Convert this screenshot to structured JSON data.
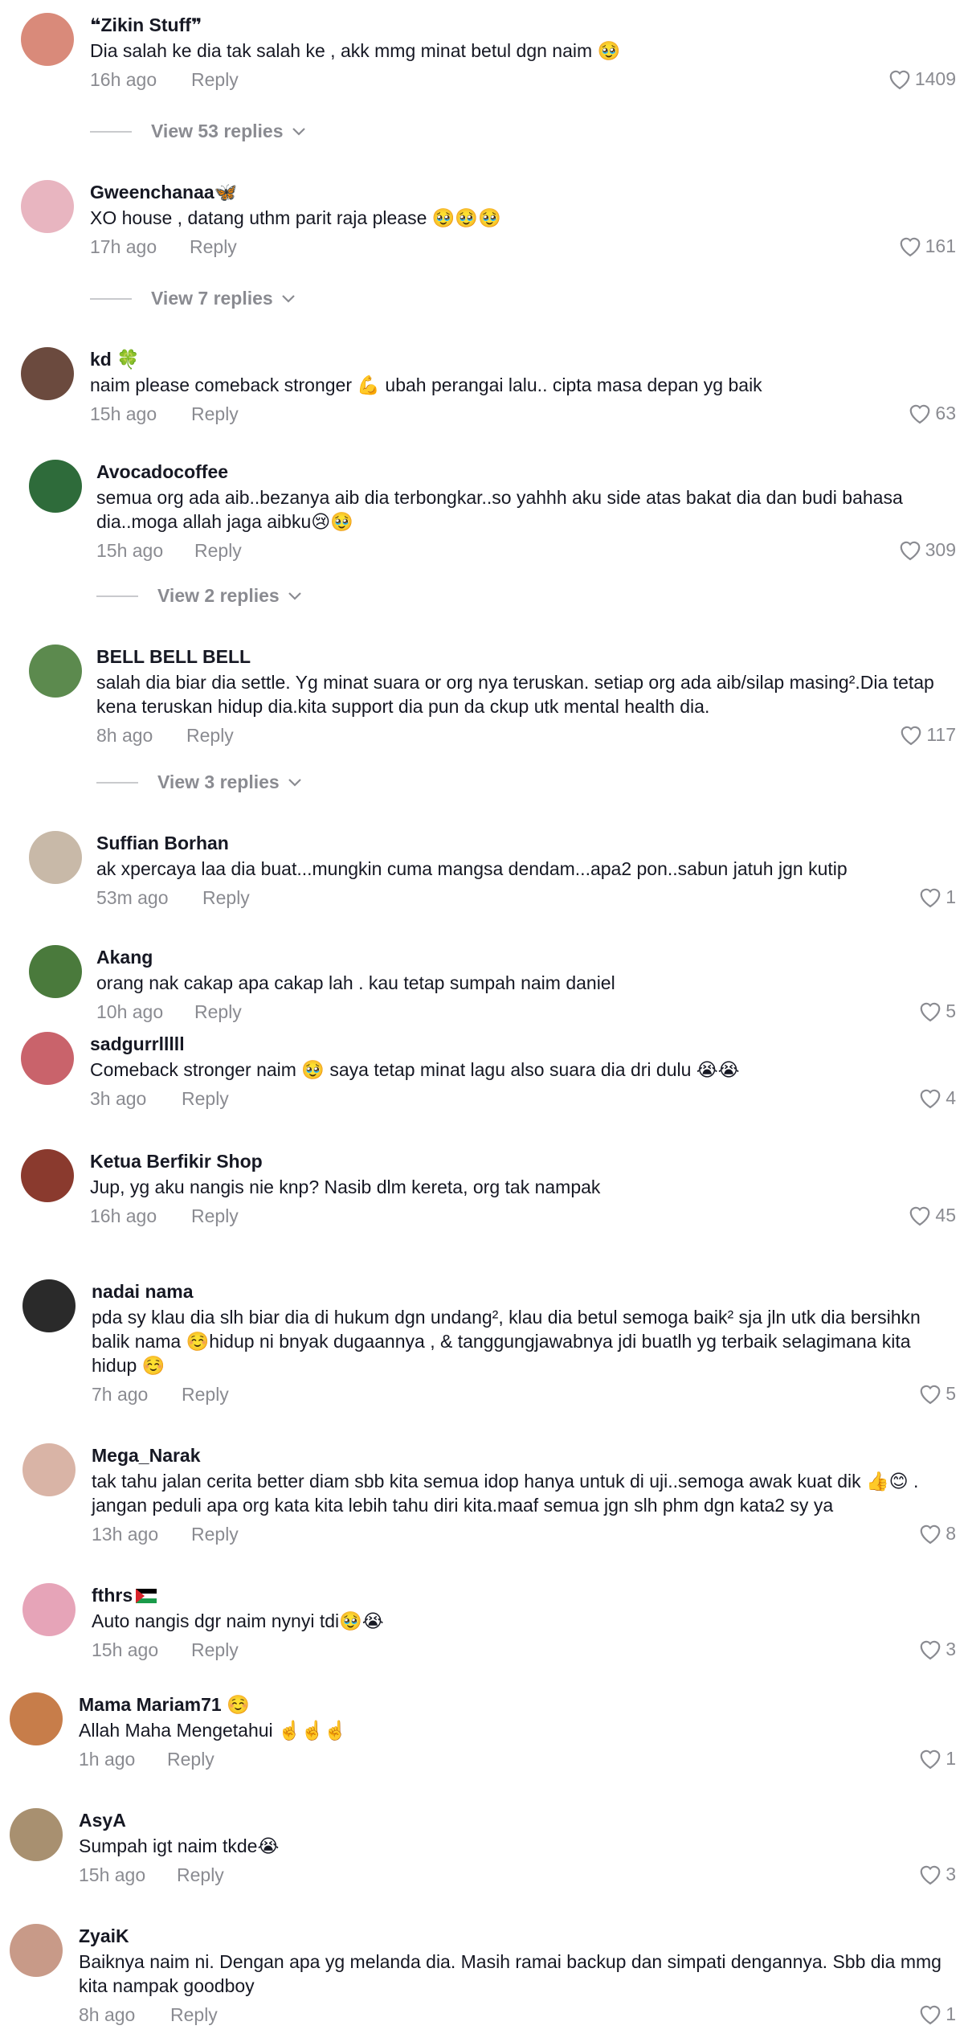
{
  "reply_label": "Reply",
  "comments": [
    {
      "name": "❝Zikin Stuff❞",
      "text": "Dia salah ke dia tak salah ke , akk mmg minat betul dgn naim 🥹",
      "time": "16h ago",
      "likes": "1409",
      "view_replies": "View 53 replies"
    },
    {
      "name": "Gweenchanaa🦋",
      "text": "XO house , datang uthm parit raja please 🥹🥹🥹",
      "time": "17h ago",
      "likes": "161",
      "view_replies": "View 7 replies"
    },
    {
      "name": "kd 🍀",
      "text": "naim please comeback stronger 💪 ubah perangai lalu.. cipta masa depan yg baik",
      "time": "15h ago",
      "likes": "63"
    },
    {
      "name": "Avocadocoffee",
      "text": "semua org ada aib..bezanya aib dia terbongkar..so yahhh aku side atas bakat dia dan budi bahasa dia..moga allah jaga aibku😢🥹",
      "time": "15h ago",
      "likes": "309",
      "view_replies": "View 2 replies"
    },
    {
      "name": "BELL BELL BELL",
      "text": "salah dia biar dia settle. Yg minat suara or org nya teruskan. setiap org ada aib/silap masing².Dia tetap kena teruskan hidup dia.kita support dia pun da ckup utk mental health dia.",
      "time": "8h ago",
      "likes": "117",
      "view_replies": "View 3 replies"
    },
    {
      "name": "Suffian Borhan",
      "text": "ak xpercaya laa dia buat...mungkin cuma mangsa dendam...apa2 pon..sabun jatuh jgn kutip",
      "time": "53m ago",
      "likes": "1"
    },
    {
      "name": "Akang",
      "text": "orang nak cakap apa cakap lah . kau tetap sumpah naim daniel",
      "time": "10h ago",
      "likes": "5"
    },
    {
      "name": "sadgurrlllll",
      "text": "Comeback stronger naim 🥹 saya tetap minat lagu also suara dia dri dulu 😭😭",
      "time": "3h ago",
      "likes": "4"
    },
    {
      "name": "Ketua Berfikir Shop",
      "text": "Jup, yg aku nangis nie knp? Nasib dlm kereta, org tak nampak",
      "time": "16h ago",
      "likes": "45"
    },
    {
      "name": "nadai nama",
      "text": "pda sy klau dia slh biar dia di hukum dgn undang², klau dia betul semoga baik² sja jln utk dia bersihkn balik nama ☺️hidup ni bnyak dugaannya , & tanggungjawabnya jdi buatlh yg terbaik selagimana kita hidup ☺️",
      "time": "7h ago",
      "likes": "5"
    },
    {
      "name": "Mega_Narak",
      "text": "tak tahu jalan cerita better diam sbb kita semua idop hanya untuk di uji..semoga awak kuat dik 👍😊 . jangan peduli apa org kata kita lebih tahu diri kita.maaf semua jgn slh phm dgn kata2 sy ya",
      "time": "13h ago",
      "likes": "8"
    },
    {
      "name": "fthrs",
      "text": "Auto nangis dgr naim nynyi tdi🥹😭",
      "time": "15h ago",
      "likes": "3"
    },
    {
      "name": "Mama Mariam71 ☺️",
      "text": "Allah Maha Mengetahui ☝️☝️☝️",
      "time": "1h ago",
      "likes": "1"
    },
    {
      "name": "AsyA",
      "text": "Sumpah igt naim tkde😭",
      "time": "15h ago",
      "likes": "3"
    },
    {
      "name": "ZyaiK",
      "text": "Baiknya naim ni. Dengan apa yg melanda dia. Masih ramai backup dan simpati dengannya. Sbb dia mmg kita nampak goodboy",
      "time": "8h ago",
      "likes": "1"
    }
  ],
  "avatar_colors": [
    "#d98a7a",
    "#e8b5c0",
    "#6b4a3e",
    "#2e6b3a",
    "#5c8a4e",
    "#c8b9a8",
    "#4a7a3c",
    "#c9636b",
    "#8a3a2e",
    "#2a2a2a",
    "#d9b4a6",
    "#e6a4b8",
    "#c77d4a",
    "#a89070",
    "#c89a88"
  ]
}
